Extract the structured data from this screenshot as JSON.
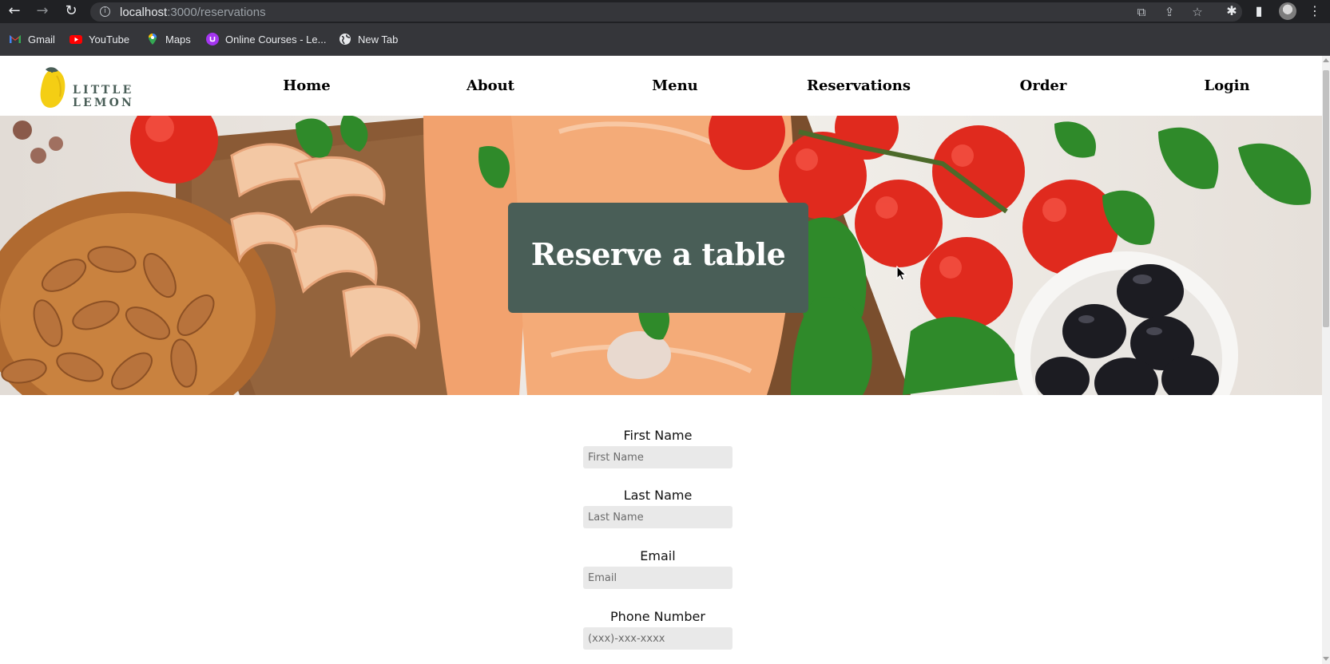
{
  "browser": {
    "url_host": "localhost",
    "url_path": ":3000/reservations",
    "bookmarks": [
      {
        "label": "Gmail",
        "icon": "gmail-icon"
      },
      {
        "label": "YouTube",
        "icon": "youtube-icon"
      },
      {
        "label": "Maps",
        "icon": "maps-icon"
      },
      {
        "label": "Online Courses - Le...",
        "icon": "udemy-icon"
      },
      {
        "label": "New Tab",
        "icon": "globe-icon"
      }
    ]
  },
  "site": {
    "logo_text": "LITTLE LEMON",
    "nav": [
      {
        "label": "Home"
      },
      {
        "label": "About"
      },
      {
        "label": "Menu"
      },
      {
        "label": "Reservations"
      },
      {
        "label": "Order"
      },
      {
        "label": "Login"
      }
    ],
    "hero_title": "Reserve a table",
    "form": {
      "first_name": {
        "label": "First Name",
        "placeholder": "First Name"
      },
      "last_name": {
        "label": "Last Name",
        "placeholder": "Last Name"
      },
      "email": {
        "label": "Email",
        "placeholder": "Email"
      },
      "phone": {
        "label": "Phone Number",
        "placeholder": "(xxx)-xxx-xxxx"
      }
    }
  },
  "colors": {
    "brand_green": "#495e57",
    "lemon_yellow": "#f4ce14",
    "chrome_dark": "#202124"
  }
}
